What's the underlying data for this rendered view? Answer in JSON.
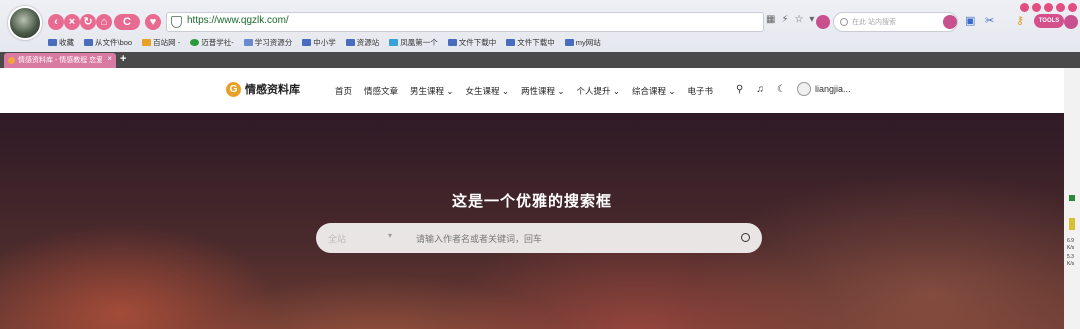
{
  "browser": {
    "url": "https://www.qgzlk.com/",
    "search_placeholder": "在此 站内搜索",
    "tools_label": "TOOLS",
    "nav": {
      "reload": "C"
    },
    "bookmarks": [
      {
        "label": "收藏"
      },
      {
        "label": "从文件\\boo"
      },
      {
        "label": "百站网 -"
      },
      {
        "label": "迈普学社-"
      },
      {
        "label": "学习资源分"
      },
      {
        "label": "中小学"
      },
      {
        "label": "资源站"
      },
      {
        "label": "凤凰第一个"
      },
      {
        "label": "文件下载中"
      },
      {
        "label": "文件下载中"
      },
      {
        "label": "my网站"
      }
    ],
    "tab": {
      "title": "情感资料库 - 情感教程 恋爱"
    },
    "accent_color": "#e96a90"
  },
  "site": {
    "logo_text": "情感资料库",
    "menu": [
      {
        "label": "首页"
      },
      {
        "label": "情感文章"
      },
      {
        "label": "男生课程 ⌄"
      },
      {
        "label": "女生课程 ⌄"
      },
      {
        "label": "两性课程 ⌄"
      },
      {
        "label": "个人提升 ⌄"
      },
      {
        "label": "综合课程 ⌄"
      },
      {
        "label": "电子书"
      }
    ],
    "username": "liangjia...",
    "hero_title": "这是一个优雅的搜索框",
    "search_scope": "全站",
    "search_placeholder": "请输入作者名或者关键词，回车"
  },
  "sidebar": {
    "labels": [
      "6.9",
      "K/s",
      "5.3",
      "K/s"
    ]
  }
}
